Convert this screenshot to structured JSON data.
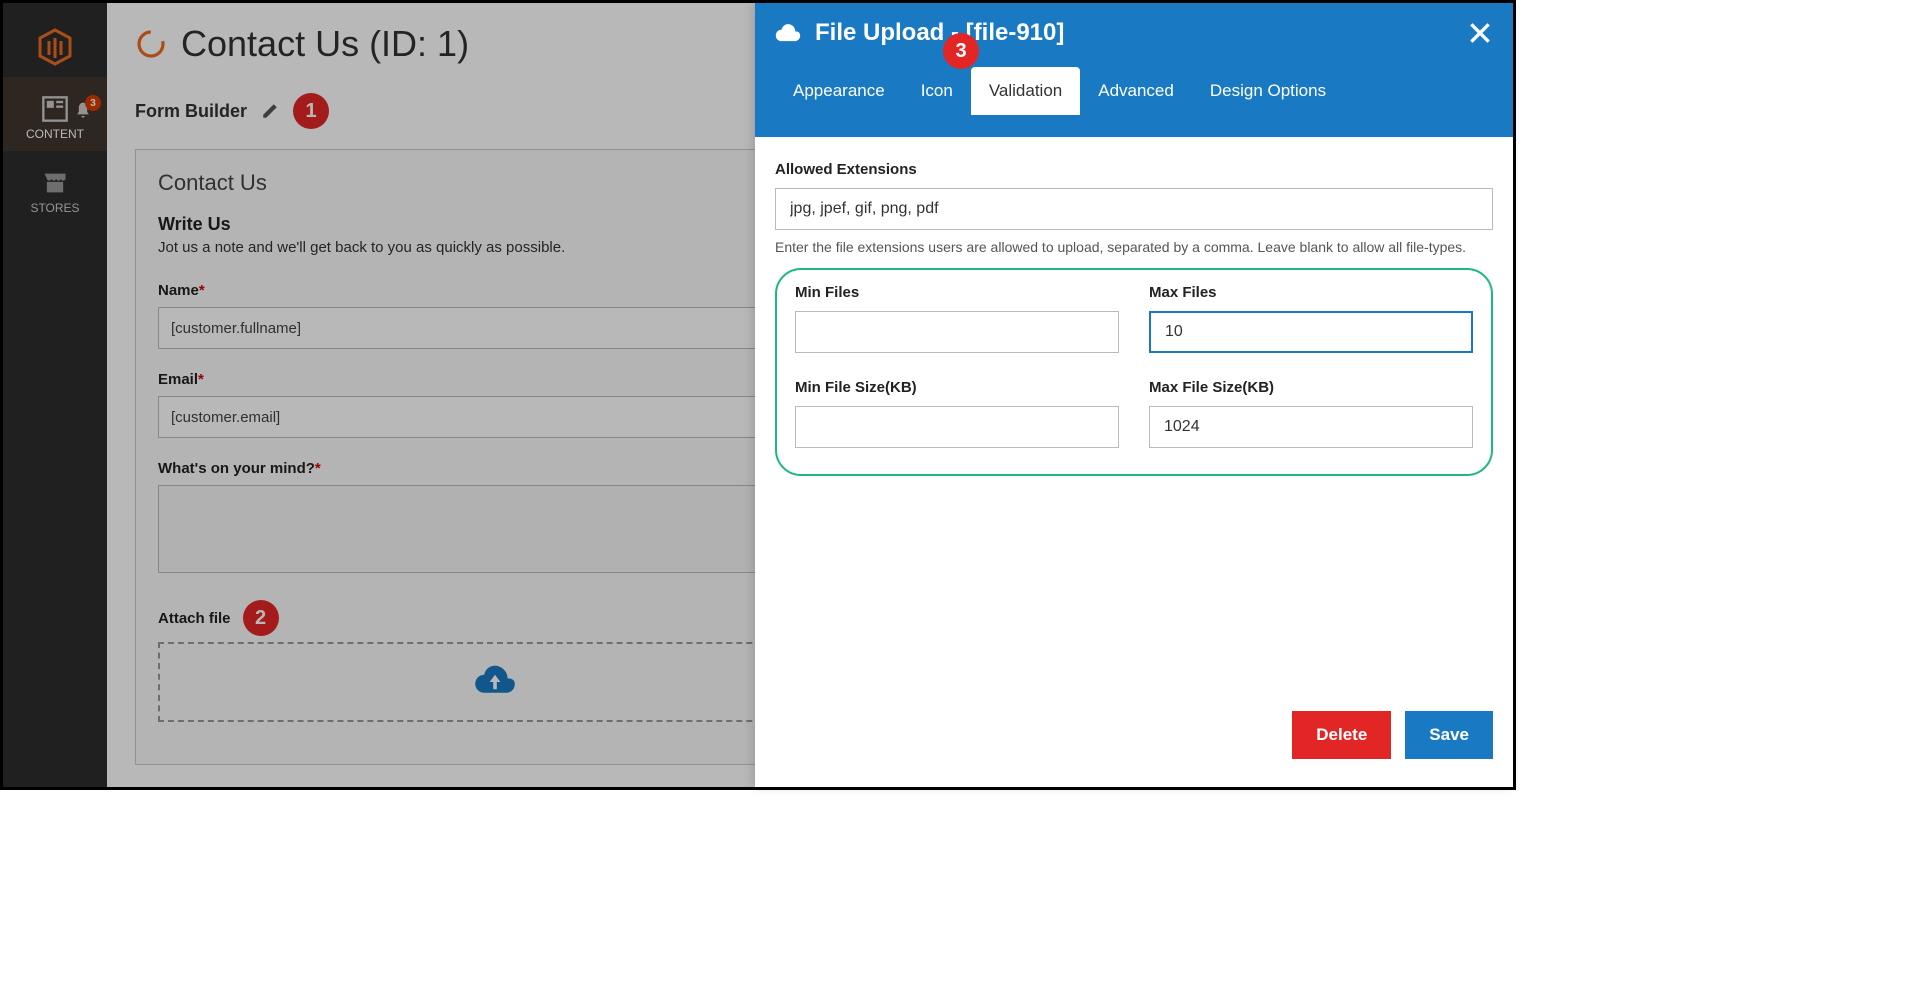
{
  "sidebar": {
    "content_label": "CONTENT",
    "stores_label": "STORES",
    "notif_count": "3"
  },
  "page": {
    "title": "Contact Us (ID: 1)",
    "section": "Form Builder",
    "badge1": "1"
  },
  "canvas": {
    "heading": "Contact Us",
    "subheading": "Write Us",
    "desc": "Jot us a note and we'll get back to you as quickly as possible.",
    "name_label": "Name",
    "name_value": "[customer.fullname]",
    "email_label": "Email",
    "email_value": "[customer.email]",
    "mind_label": "What's on your mind?",
    "attach_label": "Attach file",
    "badge2": "2"
  },
  "panel": {
    "title": "File Upload - [file-910]",
    "badge3": "3",
    "tabs": {
      "appearance": "Appearance",
      "icon": "Icon",
      "validation": "Validation",
      "advanced": "Advanced",
      "design": "Design Options"
    },
    "allowed_ext_label": "Allowed Extensions",
    "allowed_ext_value": "jpg, jpef, gif, png, pdf",
    "allowed_ext_hint": "Enter the file extensions users are allowed to upload, separated by a comma. Leave blank to allow all file-types.",
    "min_files_label": "Min Files",
    "min_files_value": "",
    "max_files_label": "Max Files",
    "max_files_value": "10",
    "min_size_label": "Min File Size(KB)",
    "min_size_value": "",
    "max_size_label": "Max File Size(KB)",
    "max_size_value": "1024",
    "delete_label": "Delete",
    "save_label": "Save"
  }
}
